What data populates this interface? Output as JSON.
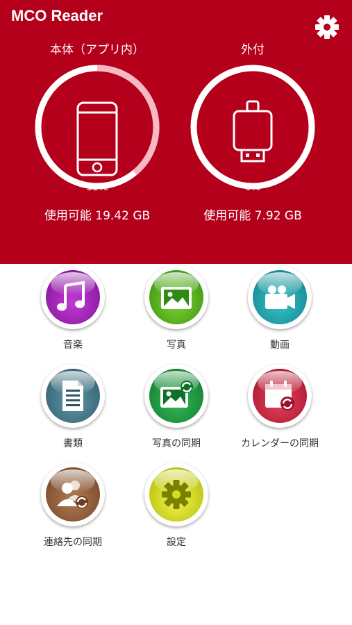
{
  "app": {
    "title": "MCO Reader"
  },
  "storage": {
    "internal": {
      "label": "本体（アプリ内）",
      "percent_text": "39%",
      "used_fraction": 0.39,
      "available_text": "使用可能 19.42 GB"
    },
    "external": {
      "label": "外付",
      "percent_text": "0%",
      "used_fraction": 0.0,
      "available_text": "使用可能 7.92 GB"
    }
  },
  "menu": [
    {
      "label": "音楽",
      "icon": "music-note-icon",
      "color": "#9b1fb0"
    },
    {
      "label": "写真",
      "icon": "photo-icon",
      "color": "#4caa1a"
    },
    {
      "label": "動画",
      "icon": "video-camera-icon",
      "color": "#1a9aa5"
    },
    {
      "label": "書類",
      "icon": "document-icon",
      "color": "#3f6f7f"
    },
    {
      "label": "写真の同期",
      "icon": "photo-sync-icon",
      "color": "#1d9a3a"
    },
    {
      "label": "カレンダーの同期",
      "icon": "calendar-sync-icon",
      "color": "#c81e3c"
    },
    {
      "label": "連絡先の同期",
      "icon": "contacts-sync-icon",
      "color": "#8a5a3a"
    },
    {
      "label": "設定",
      "icon": "gear-icon",
      "color": "#c8d200"
    }
  ],
  "colors": {
    "brand_red": "#b5001c",
    "ring_used": "#f6b8c2"
  }
}
